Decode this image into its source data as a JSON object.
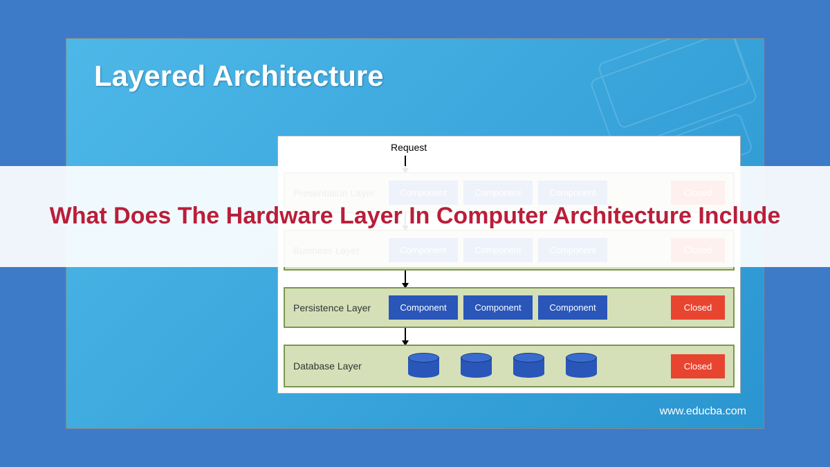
{
  "title": "Layered Architecture",
  "request_label": "Request",
  "layers": [
    {
      "name": "Presentation Layer",
      "components": [
        "Component",
        "Component",
        "Component"
      ],
      "status": "Closed"
    },
    {
      "name": "Business Layer",
      "components": [
        "Component",
        "Component",
        "Component"
      ],
      "status": "Closed"
    },
    {
      "name": "Persistence Layer",
      "components": [
        "Component",
        "Component",
        "Component"
      ],
      "status": "Closed"
    },
    {
      "name": "Database Layer",
      "status": "Closed",
      "cylinder_count": 4
    }
  ],
  "watermark": "www.educba.com",
  "overlay_title": "What Does The Hardware Layer In Computer Architecture Include",
  "colors": {
    "outer_bg": "#3d7bc8",
    "inner_bg_start": "#4db8e8",
    "inner_bg_end": "#2a95d0",
    "layer_fill": "#d5e0b8",
    "layer_border": "#7a9650",
    "component": "#2956b8",
    "closed": "#e84530",
    "overlay_text": "#b91e3a"
  }
}
